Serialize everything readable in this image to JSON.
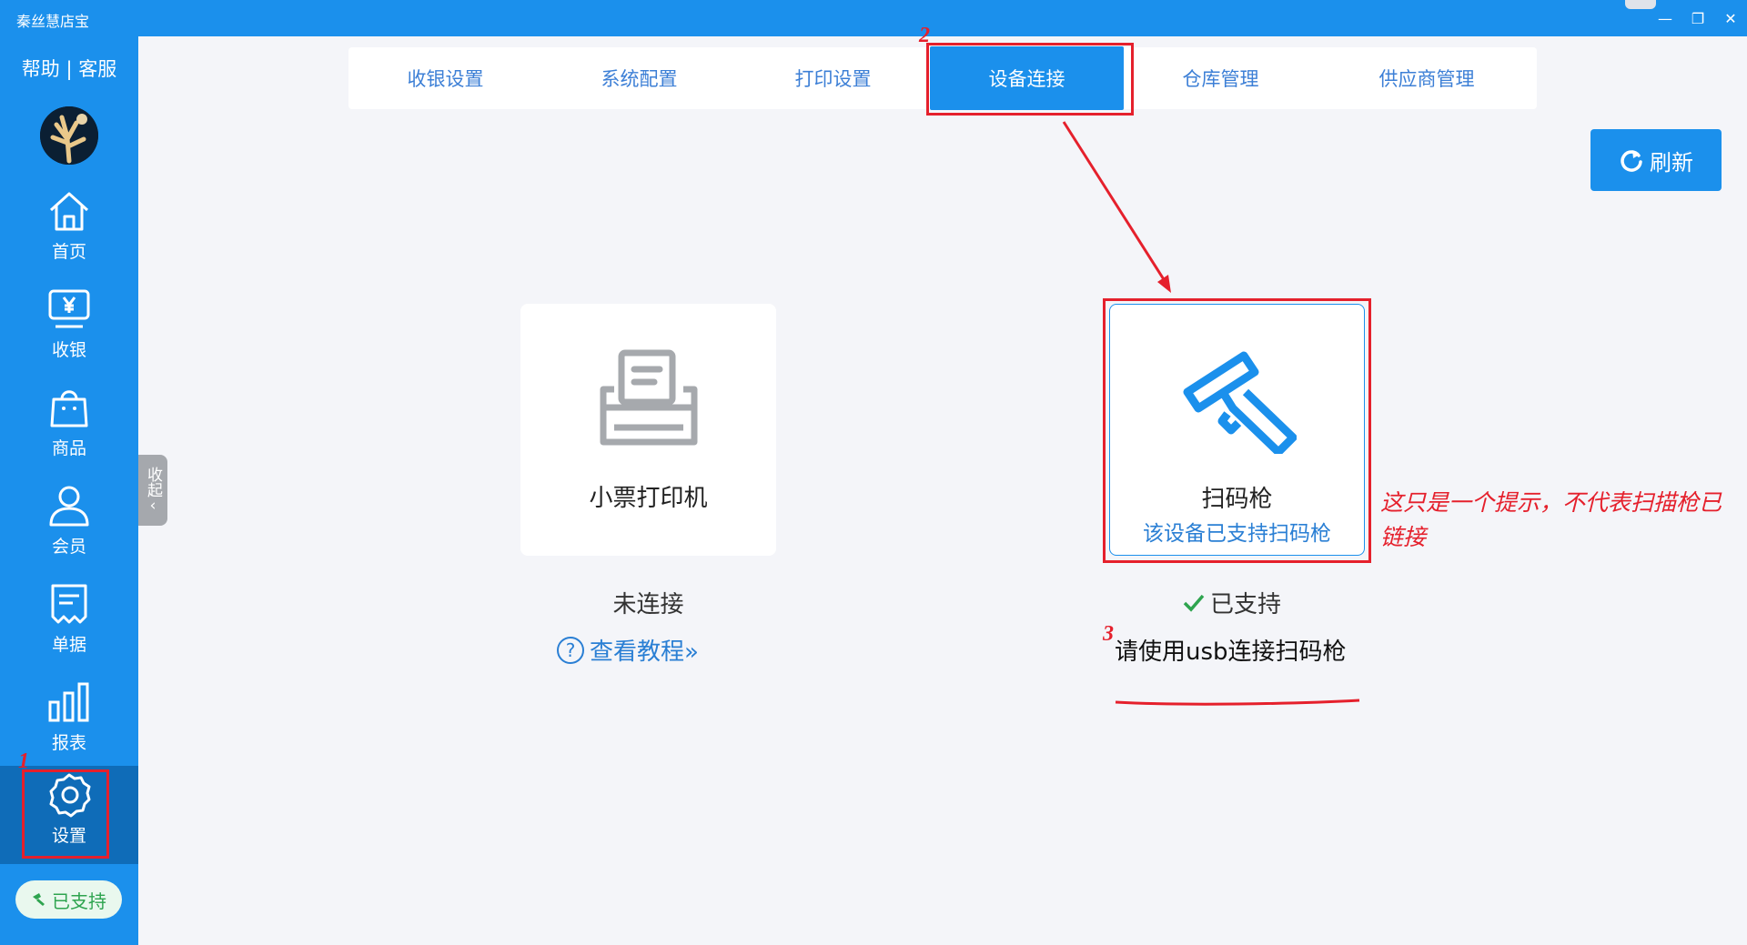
{
  "window": {
    "title": "秦丝慧店宝",
    "minimize": "—",
    "restore": "❐",
    "close": "✕"
  },
  "sidebar": {
    "help": "帮助 | 客服",
    "items": [
      {
        "label": "首页",
        "icon": "home-icon"
      },
      {
        "label": "收银",
        "icon": "cashier-icon"
      },
      {
        "label": "商品",
        "icon": "shopping-bag-icon"
      },
      {
        "label": "会员",
        "icon": "user-icon"
      },
      {
        "label": "单据",
        "icon": "receipt-icon"
      },
      {
        "label": "报表",
        "icon": "bar-chart-icon"
      },
      {
        "label": "设置",
        "icon": "gear-icon",
        "active": true
      }
    ],
    "support_label": "已支持",
    "collapse_label": "收起"
  },
  "tabs": [
    {
      "label": "收银设置"
    },
    {
      "label": "系统配置"
    },
    {
      "label": "打印设置"
    },
    {
      "label": "设备连接",
      "active": true
    },
    {
      "label": "仓库管理"
    },
    {
      "label": "供应商管理"
    }
  ],
  "refresh_label": "刷新",
  "devices": {
    "printer": {
      "name": "小票打印机",
      "status": "未连接",
      "help": "查看教程»"
    },
    "scanner": {
      "name": "扫码枪",
      "sub": "该设备已支持扫码枪",
      "status": "已支持",
      "hint": "请使用usb连接扫码枪"
    }
  },
  "annotations": {
    "num1": "1",
    "num2": "2",
    "num3": "3",
    "note": "这只是一个提示，不代表扫描枪已链接"
  },
  "colors": {
    "primary": "#1b90ec",
    "annotation": "#e5202c",
    "success": "#2ea44f"
  }
}
